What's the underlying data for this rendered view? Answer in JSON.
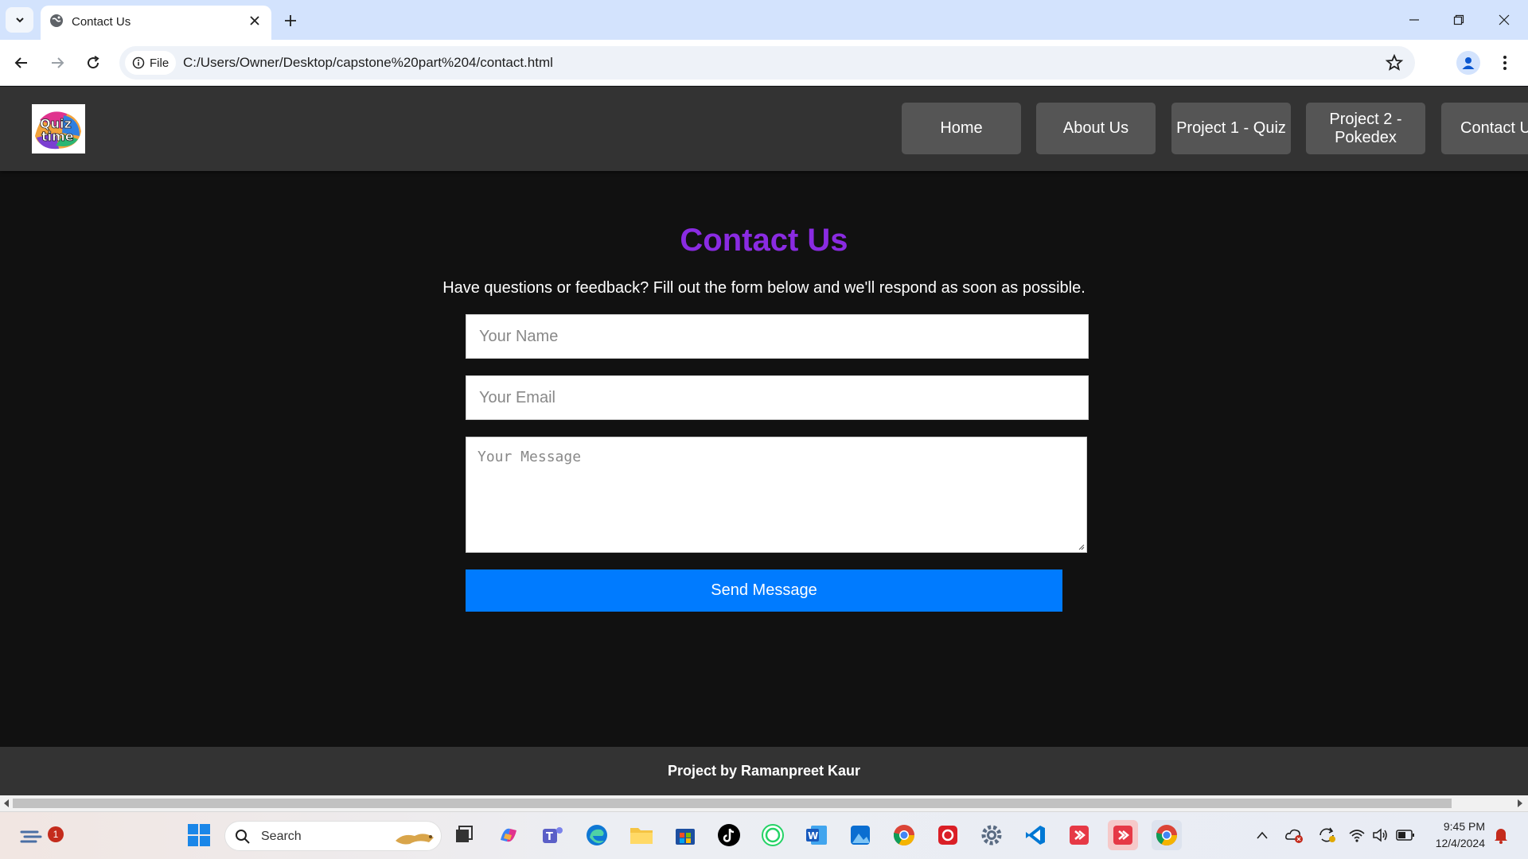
{
  "browser": {
    "tab_title": "Contact Us",
    "site_chip_label": "File",
    "url": "C:/Users/Owner/Desktop/capstone%20part%204/contact.html"
  },
  "header": {
    "nav": [
      {
        "label": "Home"
      },
      {
        "label": "About Us"
      },
      {
        "label": "Project 1 - Quiz"
      },
      {
        "label": "Project 2 - Pokedex"
      },
      {
        "label": "Contact Us"
      }
    ],
    "logo_text": "Quiz time"
  },
  "main": {
    "title": "Contact Us",
    "description": "Have questions or feedback? Fill out the form below and we'll respond as soon as possible.",
    "name_placeholder": "Your Name",
    "email_placeholder": "Your Email",
    "message_placeholder": "Your Message",
    "send_label": "Send Message"
  },
  "footer": {
    "text": "Project by Ramanpreet Kaur"
  },
  "taskbar": {
    "search_label": "Search",
    "notification_count": "1",
    "time": "9:45 PM",
    "date": "12/4/2024"
  },
  "colors": {
    "title_purple": "#8a2be2",
    "button_blue": "#007bff",
    "header_gray": "#333333",
    "nav_button": "#555555"
  }
}
